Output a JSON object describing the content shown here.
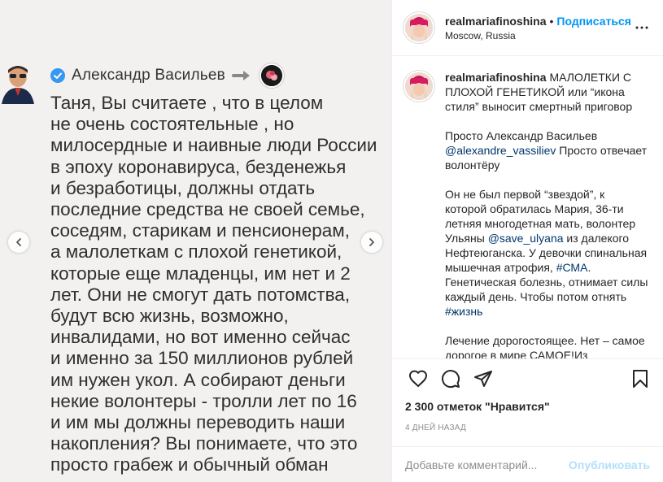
{
  "media": {
    "author_name": "Александр Васильев",
    "quote_text": "Таня, Вы считаете , что в целом\nне очень состоятельные , но\nмилосердные и наивные люди России\nв эпоху коронавируса, безденежья\nи безработицы, должны отдать\nпоследние средства не своей семье,\nсоседям, старикам и пенсионерам,\nа малолеткам с плохой генетикой,\nкоторые еще младенцы, им нет и 2\nлет. Они не смогут дать потомства,\nбудут всю жизнь, возможно,\nинвалидами, но вот именно сейчас\nи именно за 150 миллионов рублей\nим нужен укол. А собирают деньги\nнекие волонтеры - тролли лет по 16\nи им мы должны переводить наши\nнакопления? Вы понимаете, что это\nпросто грабеж и обычный обман"
  },
  "header": {
    "username": "realmariafinoshina",
    "separator": "•",
    "follow_label": "Подписаться",
    "location": "Moscow, Russia"
  },
  "caption": {
    "username": "realmariafinoshina",
    "p1": "МАЛОЛЕТКИ С ПЛОХОЙ ГЕНЕТИКОЙ или “икона стиля” выносит смертный приговор",
    "p2_before": "Просто Александр Васильев ",
    "p2_mention": "@alexandre_vassiliev",
    "p2_after": " Просто отвечает волонтёру",
    "p3_a": "Он не был первой “звездой”, к которой обратилась Мария, 36-ти летняя многодетная мать, волонтер Ульяны ",
    "p3_mention": "@save_ulyana",
    "p3_b": " из далекого Нефтеюганска. У девочки спинальная мышечная атрофия, ",
    "p3_tag1": "#СМА",
    "p3_c": ". Генетическая болезнь, отнимает силы каждый день. Чтобы потом отнять ",
    "p3_tag2": "#жизнь",
    "p4": "Лечение дорогостоящее. Нет – самое дорогое в мире САМОЕ!Из"
  },
  "actions": {
    "likes": "2 300 отметок \"Нравится\"",
    "timestamp": "4 дней назад"
  },
  "comment": {
    "placeholder": "Добавьте комментарий...",
    "publish_label": "Опубликовать"
  },
  "icons": [
    "verified-icon",
    "arrow-right-icon",
    "chevron-left-icon",
    "chevron-right-icon",
    "more-icon",
    "heart-icon",
    "comment-icon",
    "share-icon",
    "bookmark-icon"
  ],
  "colors": {
    "accent": "#0095f6",
    "link": "#00376b",
    "publish_disabled": "#b2dffc",
    "verified": "#3897f0"
  }
}
